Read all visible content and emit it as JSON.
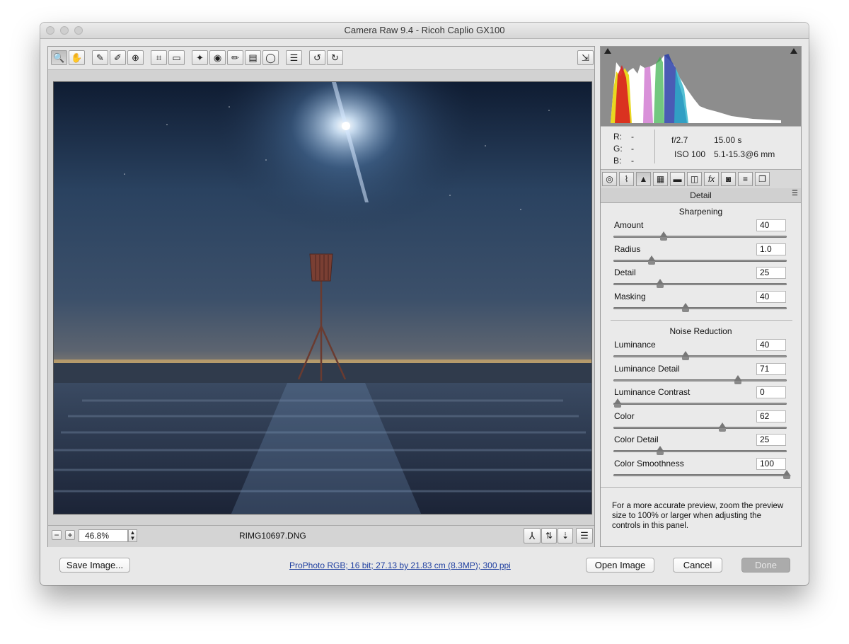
{
  "window": {
    "title": "Camera Raw 9.4  -  Ricoh Caplio GX100"
  },
  "toolbar": {
    "tools": [
      {
        "name": "zoom-tool",
        "glyph": "🔍"
      },
      {
        "name": "hand-tool",
        "glyph": "✋"
      },
      {
        "name": "white-balance-tool",
        "glyph": "✎"
      },
      {
        "name": "color-sampler-tool",
        "glyph": "✐"
      },
      {
        "name": "targeted-adjustment-tool",
        "glyph": "⊕"
      },
      {
        "name": "crop-tool",
        "glyph": "⌗"
      },
      {
        "name": "straighten-tool",
        "glyph": "▭"
      },
      {
        "name": "spot-removal-tool",
        "glyph": "✦"
      },
      {
        "name": "red-eye-tool",
        "glyph": "◉"
      },
      {
        "name": "adjustment-brush-tool",
        "glyph": "✏"
      },
      {
        "name": "graduated-filter-tool",
        "glyph": "▤"
      },
      {
        "name": "radial-filter-tool",
        "glyph": "◯"
      },
      {
        "name": "preferences-tool",
        "glyph": "☰"
      },
      {
        "name": "rotate-left-tool",
        "glyph": "↺"
      },
      {
        "name": "rotate-right-tool",
        "glyph": "↻"
      }
    ],
    "fullscreen_glyph": "⇲"
  },
  "bottom_bar": {
    "zoom_out": "−",
    "zoom_in": "+",
    "zoom_value": "46.8%",
    "filename": "RIMG10697.DNG"
  },
  "info": {
    "r_label": "R:",
    "r_value": "---",
    "g_label": "G:",
    "g_value": "---",
    "b_label": "B:",
    "b_value": "---",
    "aperture": "f/2.7",
    "shutter": "15.00 s",
    "iso": "ISO 100",
    "lens": "5.1-15.3@6 mm"
  },
  "panel": {
    "title": "Detail",
    "sharpening_heading": "Sharpening",
    "noise_heading": "Noise Reduction",
    "sharpening": [
      {
        "label": "Amount",
        "value": "40",
        "fraction": 0.27
      },
      {
        "label": "Radius",
        "value": "1.0",
        "fraction": 0.2
      },
      {
        "label": "Detail",
        "value": "25",
        "fraction": 0.25
      },
      {
        "label": "Masking",
        "value": "40",
        "fraction": 0.4
      }
    ],
    "noise": [
      {
        "label": "Luminance",
        "value": "40",
        "fraction": 0.4
      },
      {
        "label": "Luminance Detail",
        "value": "71",
        "fraction": 0.71
      },
      {
        "label": "Luminance Contrast",
        "value": "0",
        "fraction": 0.0
      },
      {
        "label": "Color",
        "value": "62",
        "fraction": 0.62
      },
      {
        "label": "Color Detail",
        "value": "25",
        "fraction": 0.25
      },
      {
        "label": "Color Smoothness",
        "value": "100",
        "fraction": 1.0
      }
    ],
    "note": "For a more accurate preview, zoom the preview size to 100% or larger when adjusting the controls in this panel."
  },
  "footer": {
    "save_label": "Save Image...",
    "workflow_link": "ProPhoto RGB; 16 bit; 27.13 by 21.83 cm (8.3MP); 300 ppi",
    "open_label": "Open Image",
    "cancel_label": "Cancel",
    "done_label": "Done"
  },
  "colors": {
    "accent_link": "#1f3fa0",
    "done_disabled": "#a8a8a8"
  }
}
